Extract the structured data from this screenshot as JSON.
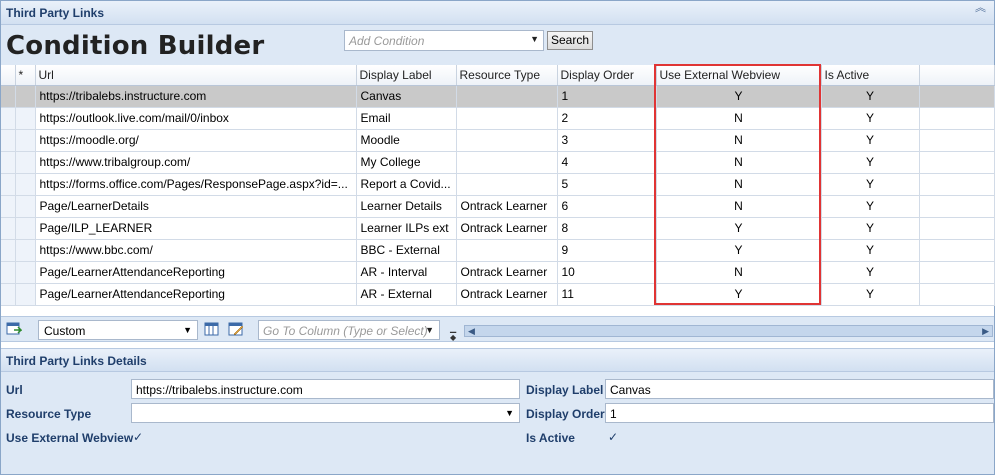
{
  "panel": {
    "title": "Third Party Links",
    "collapse_icon": "double-chevron-up-icon"
  },
  "builder": {
    "title": "Condition Builder",
    "add_condition_placeholder": "Add Condition",
    "search_label": "Search"
  },
  "grid": {
    "columns": [
      "*",
      "Url",
      "Display Label",
      "Resource Type",
      "Display Order",
      "Use External Webview",
      "Is Active"
    ],
    "rows": [
      [
        "https://tribalebs.instructure.com",
        "Canvas",
        "",
        "1",
        "Y",
        "Y"
      ],
      [
        "https://outlook.live.com/mail/0/inbox",
        "Email",
        "",
        "2",
        "N",
        "Y"
      ],
      [
        "https://moodle.org/",
        "Moodle",
        "",
        "3",
        "N",
        "Y"
      ],
      [
        "https://www.tribalgroup.com/",
        "My College",
        "",
        "4",
        "N",
        "Y"
      ],
      [
        "https://forms.office.com/Pages/ResponsePage.aspx?id=...",
        "Report a Covid...",
        "",
        "5",
        "N",
        "Y"
      ],
      [
        "Page/LearnerDetails",
        "Learner Details",
        "Ontrack Learner",
        "6",
        "N",
        "Y"
      ],
      [
        "Page/ILP_LEARNER",
        "Learner ILPs ext",
        "Ontrack Learner",
        "8",
        "Y",
        "Y"
      ],
      [
        "https://www.bbc.com/",
        "BBC - External",
        "",
        "9",
        "Y",
        "Y"
      ],
      [
        "Page/LearnerAttendanceReporting",
        "AR - Interval",
        "Ontrack Learner",
        "10",
        "N",
        "Y"
      ],
      [
        "Page/LearnerAttendanceReporting",
        "AR - External",
        "Ontrack Learner",
        "11",
        "Y",
        "Y"
      ]
    ]
  },
  "gridbar": {
    "layout_value": "Custom",
    "goto_placeholder": "Go To Column (Type or Select)"
  },
  "details": {
    "title": "Third Party Links Details",
    "url_label": "Url",
    "url_value": "https://tribalebs.instructure.com",
    "resource_type_label": "Resource Type",
    "resource_type_value": "",
    "use_external_label": "Use External Webview",
    "display_label_label": "Display Label",
    "display_label_value": "Canvas",
    "display_order_label": "Display Order",
    "display_order_value": "1",
    "is_active_label": "Is Active",
    "checkmark": "✓"
  },
  "colors": {
    "highlight": "#e03434",
    "header_text": "#1f3e6b",
    "panel_bg": "#dde8f5"
  }
}
